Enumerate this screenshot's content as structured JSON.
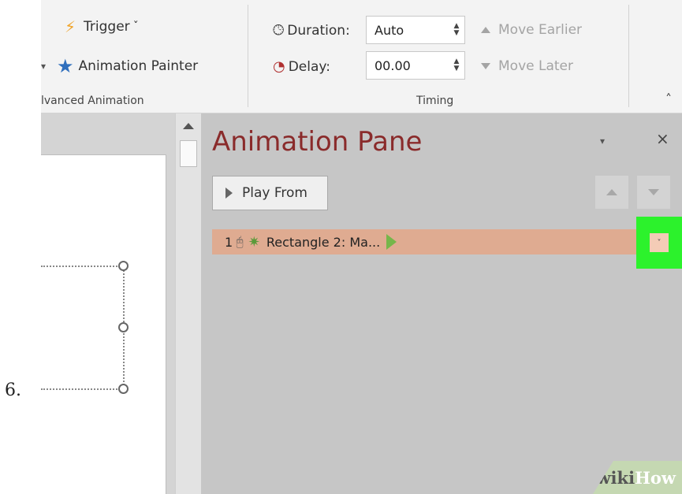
{
  "step_number": "6.",
  "ribbon": {
    "advanced_animation": {
      "trigger_label": "Trigger",
      "trigger_caret": "ˇ",
      "painter_label": "Animation Painter",
      "group_label": "lvanced Animation"
    },
    "timing": {
      "duration_label": "Duration:",
      "duration_value": "Auto",
      "delay_label": "Delay:",
      "delay_value": "00.00",
      "move_earlier_label": "Move Earlier",
      "move_later_label": "Move Later",
      "group_label": "Timing"
    },
    "collapse_glyph": "˄"
  },
  "animation_pane": {
    "title": "Animation Pane",
    "menu_glyph": "▾",
    "close_glyph": "×",
    "play_from_label": "Play From",
    "items": [
      {
        "number": "1",
        "label": "Rectangle 2: Ma...",
        "dropdown_glyph": "˅"
      }
    ]
  },
  "watermark": {
    "part1": "wiki",
    "part2": "How"
  },
  "colors": {
    "pane_title": "#8a2b2b",
    "selected_row": "#dfab91",
    "highlight": "#2cf22c",
    "trigger_icon": "#f0a42a",
    "painter_icon": "#2f6fbd"
  }
}
